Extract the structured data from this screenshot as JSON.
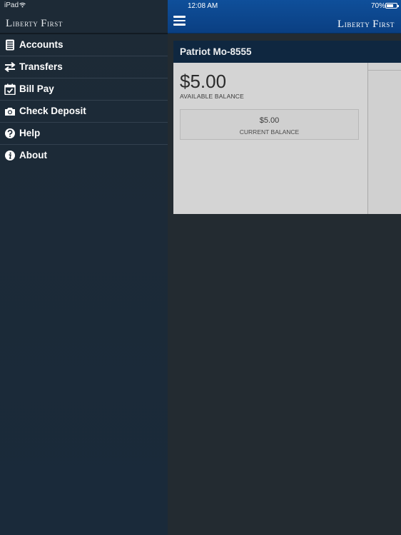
{
  "status_bar": {
    "device": "iPad",
    "time": "12:08 AM",
    "battery_percent": "70%",
    "battery_level": 0.7
  },
  "drawer": {
    "logo_first_letter_1": "L",
    "logo_rest_1": "iberty",
    "logo_first_letter_2": "F",
    "logo_rest_2": "irst",
    "menu": [
      {
        "label": "Accounts",
        "icon": "accounts-icon"
      },
      {
        "label": "Transfers",
        "icon": "transfers-icon"
      },
      {
        "label": "Bill Pay",
        "icon": "calendar-check-icon"
      },
      {
        "label": "Check Deposit",
        "icon": "camera-icon"
      },
      {
        "label": "Help",
        "icon": "help-icon"
      },
      {
        "label": "About",
        "icon": "info-icon"
      }
    ]
  },
  "header": {
    "logo_first_letter_1": "L",
    "logo_rest_1": "iberty",
    "logo_first_letter_2": "F",
    "logo_rest_2": "irst"
  },
  "account": {
    "name": "Patriot Mo-8555",
    "available_balance": "$5.00",
    "available_label": "AVAILABLE BALANCE",
    "current_balance": "$5.00",
    "current_label": "CURRENT BALANCE"
  },
  "colors": {
    "header_blue": "#0f4f9a",
    "drawer_bg": "#1d2a36",
    "card_bg": "#d4d4d4",
    "card_title_bg": "#0f2740"
  }
}
